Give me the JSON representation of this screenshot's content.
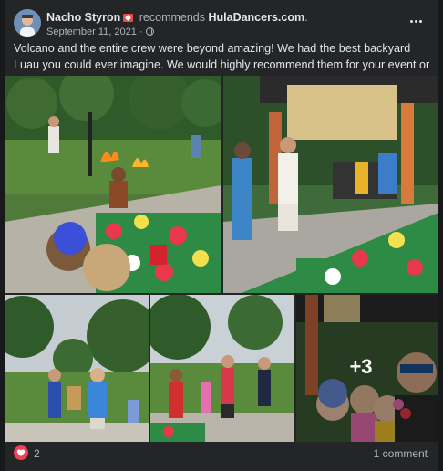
{
  "post": {
    "author": "Nacho Styron",
    "action": "recommends",
    "page": "HulaDancers.com",
    "page_suffix": ".",
    "date": "September 11, 2021",
    "date_separator": "·",
    "privacy_icon": "globe-icon",
    "text": "Volcano and the entire crew were beyond amazing! We had the best backyard Luau you could ever imagine. We would highly recommend them for your event or party!",
    "extra_photos_label": "+3"
  },
  "reactions": {
    "icon": "heart-icon",
    "count": "2",
    "comments_label": "1 comment"
  },
  "colors": {
    "card_bg": "#242526",
    "page_bg": "#18191a",
    "text_primary": "#e4e6eb",
    "text_secondary": "#b0b3b8",
    "love_reaction": "#f33e58"
  }
}
